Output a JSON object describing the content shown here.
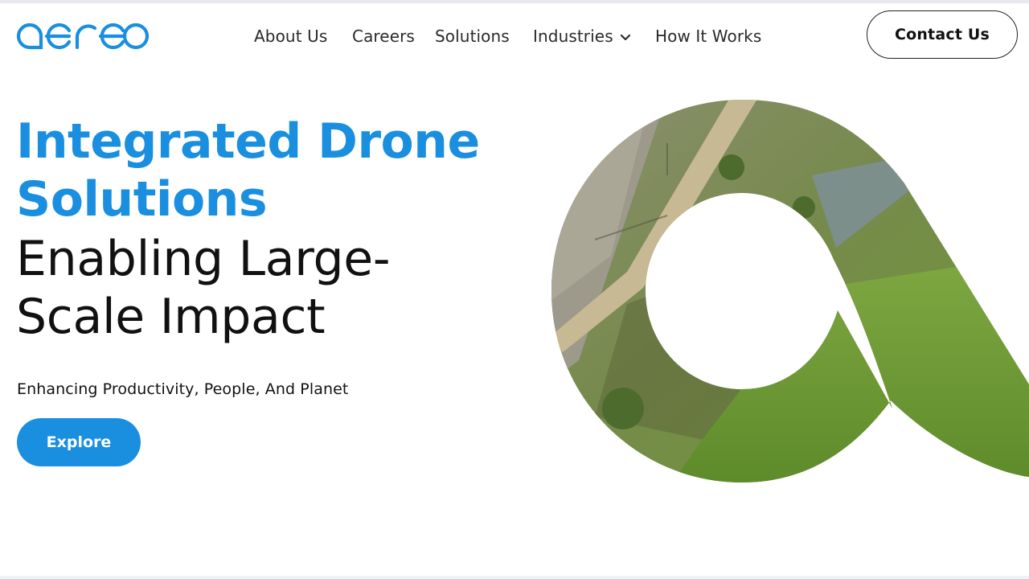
{
  "brand": {
    "logo_name": "aereo",
    "accent_color": "#1a8fdf"
  },
  "nav": {
    "items": [
      {
        "label": "About Us"
      },
      {
        "label": "Careers"
      },
      {
        "label": "Solutions"
      },
      {
        "label": "Industries",
        "has_dropdown": true
      },
      {
        "label": "How It Works"
      }
    ],
    "contact_label": "Contact Us"
  },
  "hero": {
    "title_blue_line1": "Integrated Drone",
    "title_blue_line2": "Solutions",
    "title_dark_line1": "Enabling Large-",
    "title_dark_line2": "Scale Impact",
    "subtitle": "Enhancing Productivity, People, And Planet",
    "cta_label": "Explore",
    "image": "aerial-field-photo"
  },
  "icons": {
    "dropdown": "chevron-down-icon"
  }
}
